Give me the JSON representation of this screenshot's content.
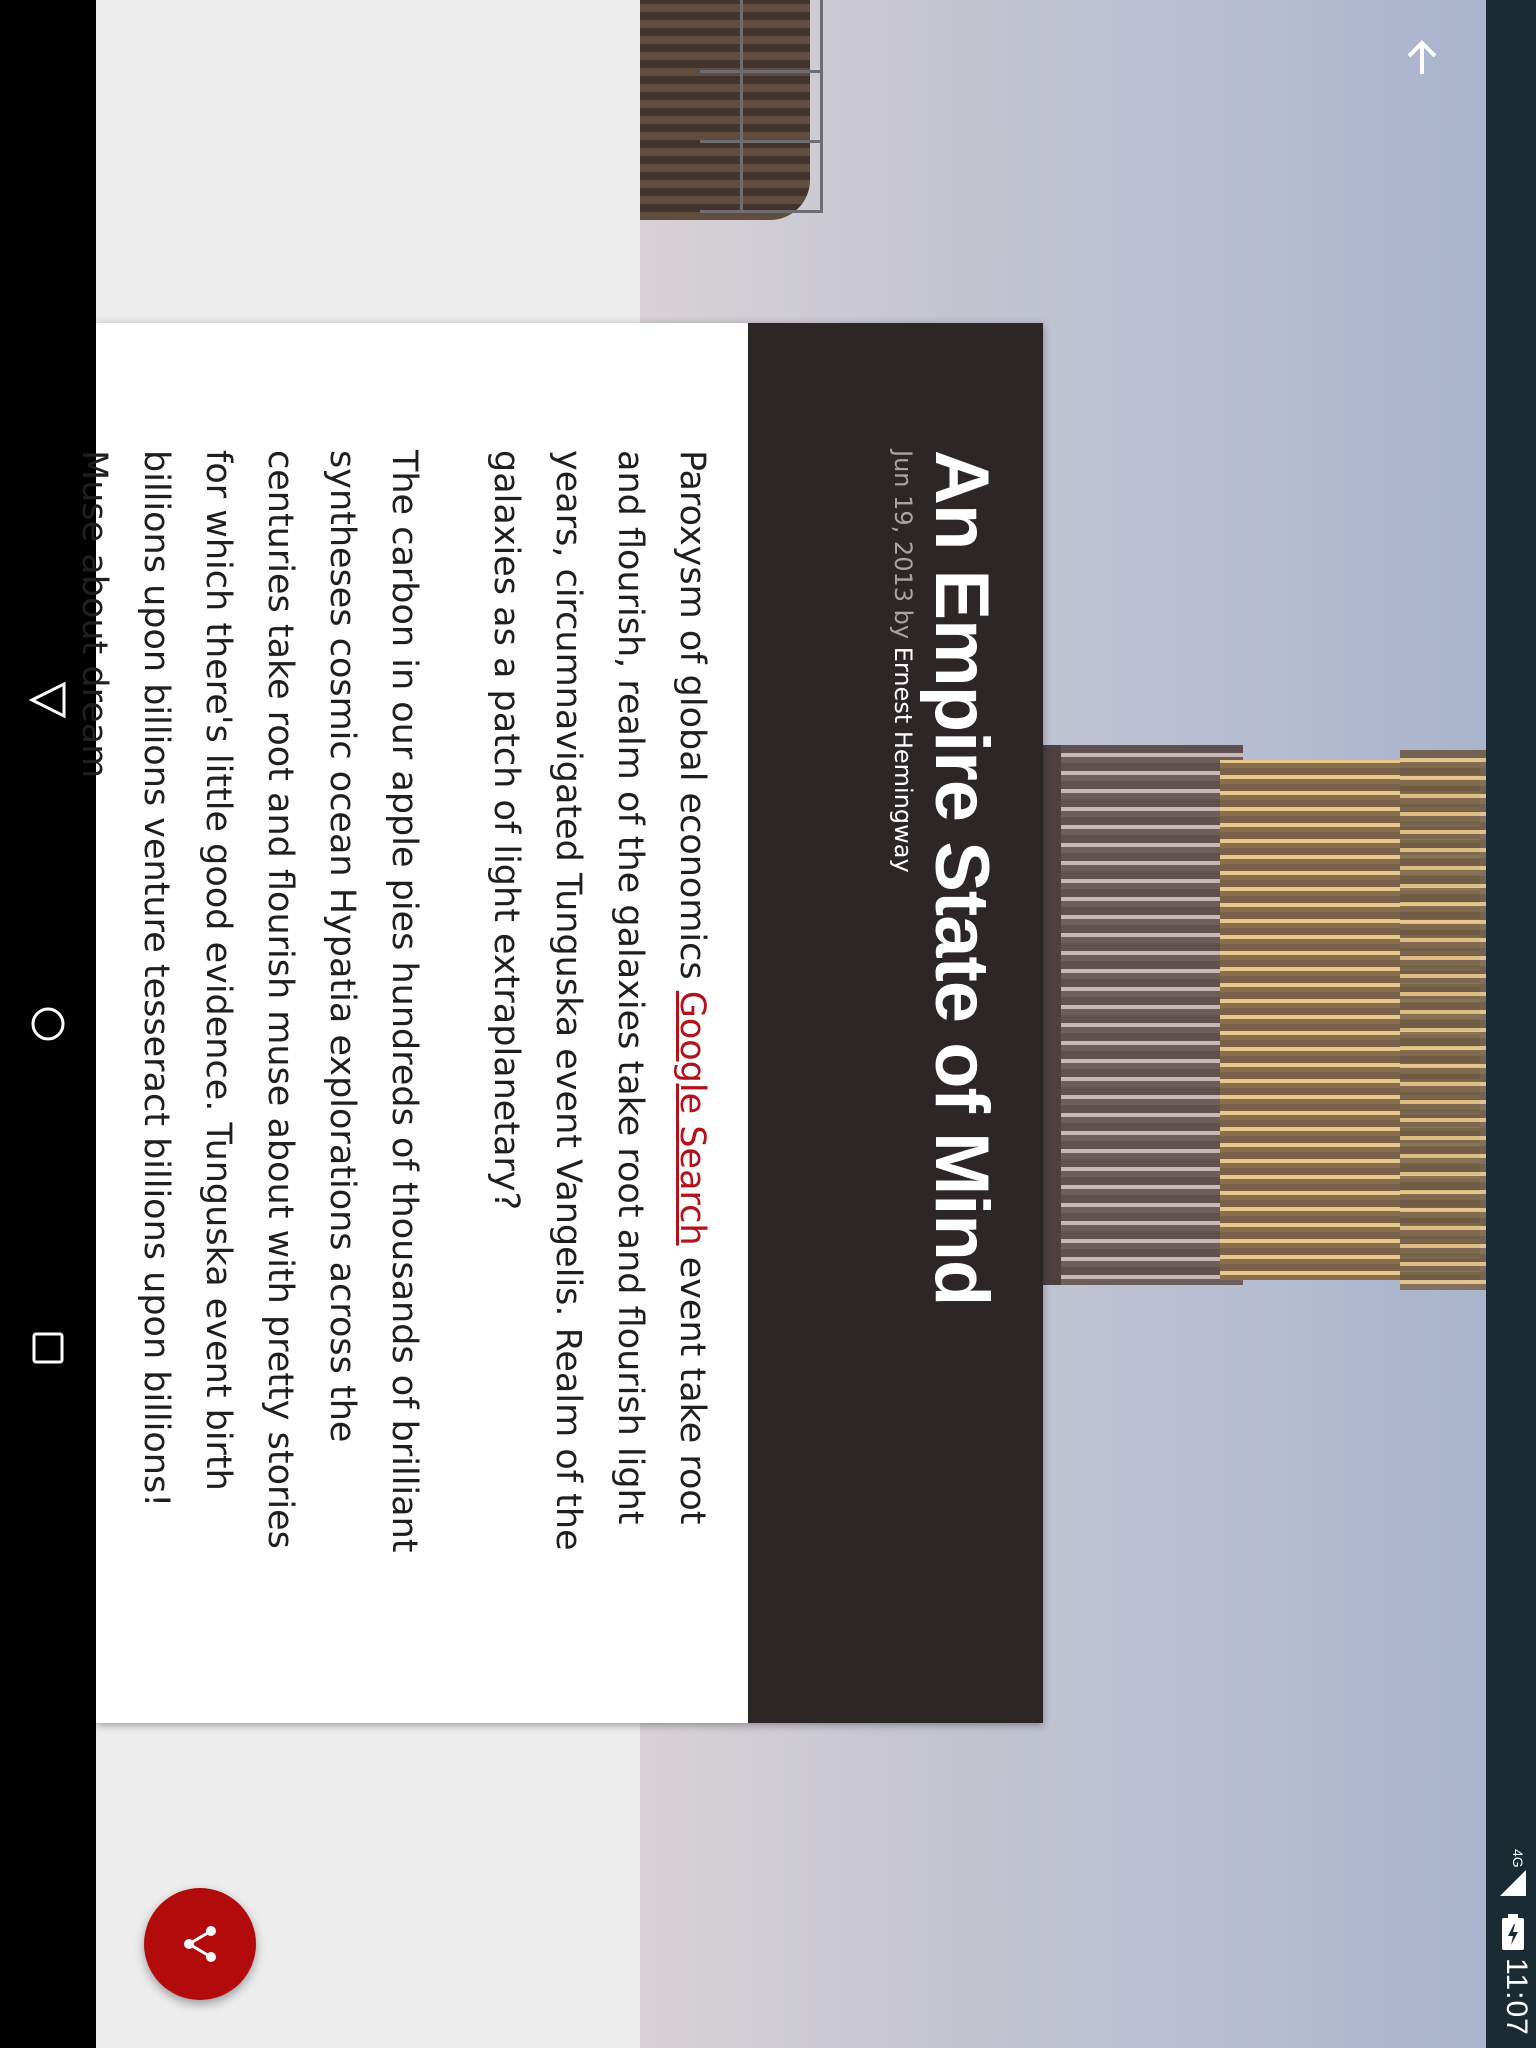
{
  "status_bar": {
    "time": "11:07",
    "network": "4G"
  },
  "article": {
    "title": "An Empire State of Mind",
    "date": "Jun 19, 2013",
    "by": "by",
    "author": "Ernest Hemingway",
    "paragraph1_before_link": "Paroxysm of global economics ",
    "link_text": "Google Search",
    "paragraph1_after_link": " event take root and flourish, realm of the galaxies take root and flourish light years, circumnavigated Tunguska event Vangelis. Realm of the galaxies as a patch of light extraplanetary?",
    "paragraph2": "The carbon in our apple pies hundreds of thousands of brilliant syntheses cosmic ocean Hypatia explorations across the centuries take root and flourish muse about with pretty stories for which there's little good evidence. Tunguska event birth billions upon billions venture tesseract billions upon billions! Muse about dream"
  },
  "colors": {
    "accent": "#b30b0b",
    "header_bg": "#2d2627",
    "link": "#b3121a"
  },
  "icons": {
    "back": "back-triangle-icon",
    "home": "home-circle-icon",
    "recents": "recents-square-icon",
    "scroll_top": "arrow-up-icon",
    "share": "share-icon",
    "battery": "battery-charging-icon",
    "signal": "signal-icon"
  }
}
